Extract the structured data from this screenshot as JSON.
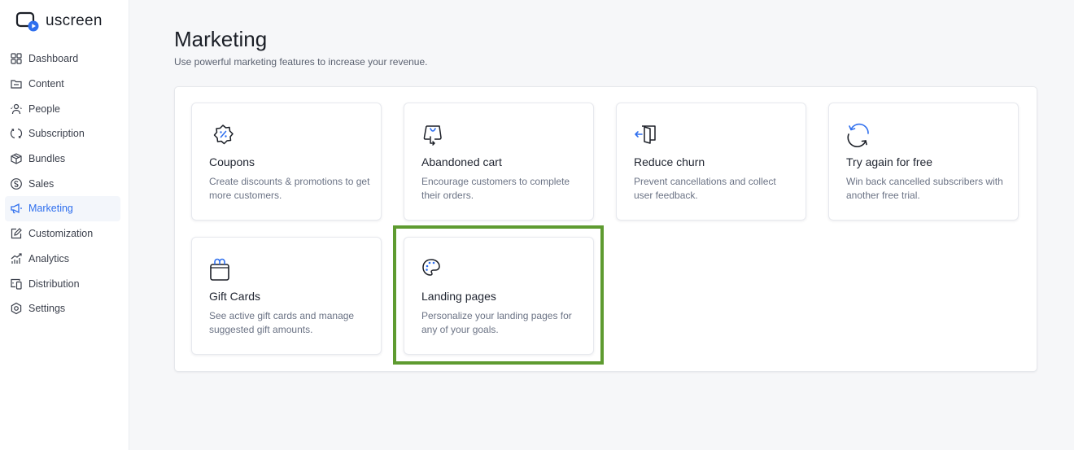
{
  "app": {
    "logo_text": "uscreen",
    "brand_color": "#2f6fee",
    "highlight_color": "#5e9b30"
  },
  "sidebar": {
    "items": [
      {
        "label": "Dashboard",
        "icon": "grid-icon",
        "active": false
      },
      {
        "label": "Content",
        "icon": "folder-icon",
        "active": false
      },
      {
        "label": "People",
        "icon": "people-icon",
        "active": false
      },
      {
        "label": "Subscription",
        "icon": "refresh-icon",
        "active": false
      },
      {
        "label": "Bundles",
        "icon": "box-icon",
        "active": false
      },
      {
        "label": "Sales",
        "icon": "dollar-circle-icon",
        "active": false
      },
      {
        "label": "Marketing",
        "icon": "megaphone-icon",
        "active": true
      },
      {
        "label": "Customization",
        "icon": "edit-icon",
        "active": false
      },
      {
        "label": "Analytics",
        "icon": "chart-icon",
        "active": false
      },
      {
        "label": "Distribution",
        "icon": "devices-icon",
        "active": false
      },
      {
        "label": "Settings",
        "icon": "settings-icon",
        "active": false
      }
    ]
  },
  "main": {
    "title": "Marketing",
    "subtitle": "Use powerful marketing features to increase your revenue.",
    "cards": [
      {
        "title": "Coupons",
        "description": "Create discounts & promotions to get more customers.",
        "icon": "coupon-icon"
      },
      {
        "title": "Abandoned cart",
        "description": "Encourage customers to complete their orders.",
        "icon": "shopping-bag-icon"
      },
      {
        "title": "Reduce churn",
        "description": "Prevent cancellations and collect user feedback.",
        "icon": "exit-door-icon"
      },
      {
        "title": "Try again for free",
        "description": "Win back cancelled subscribers with another free trial.",
        "icon": "retry-icon"
      },
      {
        "title": "Gift Cards",
        "description": "See active gift cards and manage suggested gift amounts.",
        "icon": "gift-icon"
      },
      {
        "title": "Landing pages",
        "description": "Personalize your landing pages for any of your goals.",
        "icon": "palette-icon",
        "highlighted": true
      }
    ]
  }
}
